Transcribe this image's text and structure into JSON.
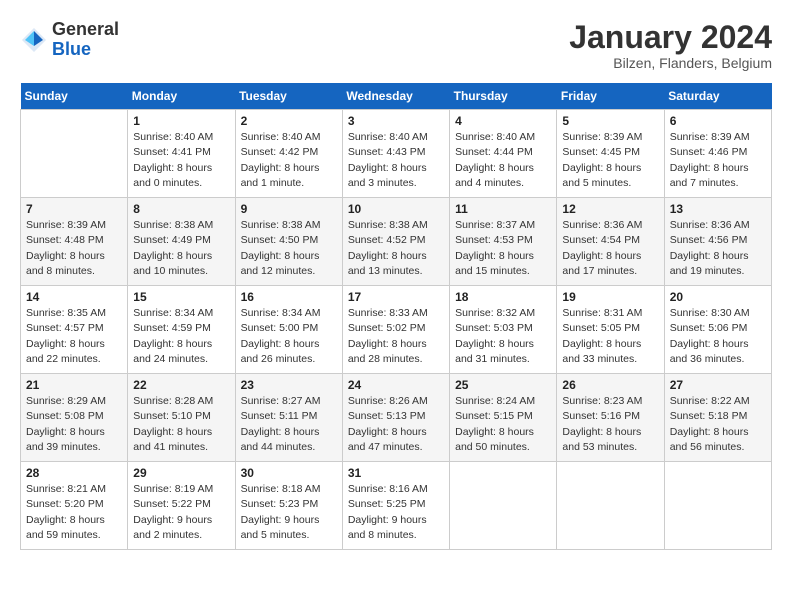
{
  "logo": {
    "general": "General",
    "blue": "Blue"
  },
  "header": {
    "month": "January 2024",
    "location": "Bilzen, Flanders, Belgium"
  },
  "weekdays": [
    "Sunday",
    "Monday",
    "Tuesday",
    "Wednesday",
    "Thursday",
    "Friday",
    "Saturday"
  ],
  "weeks": [
    [
      {
        "day": "",
        "sunrise": "",
        "sunset": "",
        "daylight": ""
      },
      {
        "day": "1",
        "sunrise": "Sunrise: 8:40 AM",
        "sunset": "Sunset: 4:41 PM",
        "daylight": "Daylight: 8 hours and 0 minutes."
      },
      {
        "day": "2",
        "sunrise": "Sunrise: 8:40 AM",
        "sunset": "Sunset: 4:42 PM",
        "daylight": "Daylight: 8 hours and 1 minute."
      },
      {
        "day": "3",
        "sunrise": "Sunrise: 8:40 AM",
        "sunset": "Sunset: 4:43 PM",
        "daylight": "Daylight: 8 hours and 3 minutes."
      },
      {
        "day": "4",
        "sunrise": "Sunrise: 8:40 AM",
        "sunset": "Sunset: 4:44 PM",
        "daylight": "Daylight: 8 hours and 4 minutes."
      },
      {
        "day": "5",
        "sunrise": "Sunrise: 8:39 AM",
        "sunset": "Sunset: 4:45 PM",
        "daylight": "Daylight: 8 hours and 5 minutes."
      },
      {
        "day": "6",
        "sunrise": "Sunrise: 8:39 AM",
        "sunset": "Sunset: 4:46 PM",
        "daylight": "Daylight: 8 hours and 7 minutes."
      }
    ],
    [
      {
        "day": "7",
        "sunrise": "Sunrise: 8:39 AM",
        "sunset": "Sunset: 4:48 PM",
        "daylight": "Daylight: 8 hours and 8 minutes."
      },
      {
        "day": "8",
        "sunrise": "Sunrise: 8:38 AM",
        "sunset": "Sunset: 4:49 PM",
        "daylight": "Daylight: 8 hours and 10 minutes."
      },
      {
        "day": "9",
        "sunrise": "Sunrise: 8:38 AM",
        "sunset": "Sunset: 4:50 PM",
        "daylight": "Daylight: 8 hours and 12 minutes."
      },
      {
        "day": "10",
        "sunrise": "Sunrise: 8:38 AM",
        "sunset": "Sunset: 4:52 PM",
        "daylight": "Daylight: 8 hours and 13 minutes."
      },
      {
        "day": "11",
        "sunrise": "Sunrise: 8:37 AM",
        "sunset": "Sunset: 4:53 PM",
        "daylight": "Daylight: 8 hours and 15 minutes."
      },
      {
        "day": "12",
        "sunrise": "Sunrise: 8:36 AM",
        "sunset": "Sunset: 4:54 PM",
        "daylight": "Daylight: 8 hours and 17 minutes."
      },
      {
        "day": "13",
        "sunrise": "Sunrise: 8:36 AM",
        "sunset": "Sunset: 4:56 PM",
        "daylight": "Daylight: 8 hours and 19 minutes."
      }
    ],
    [
      {
        "day": "14",
        "sunrise": "Sunrise: 8:35 AM",
        "sunset": "Sunset: 4:57 PM",
        "daylight": "Daylight: 8 hours and 22 minutes."
      },
      {
        "day": "15",
        "sunrise": "Sunrise: 8:34 AM",
        "sunset": "Sunset: 4:59 PM",
        "daylight": "Daylight: 8 hours and 24 minutes."
      },
      {
        "day": "16",
        "sunrise": "Sunrise: 8:34 AM",
        "sunset": "Sunset: 5:00 PM",
        "daylight": "Daylight: 8 hours and 26 minutes."
      },
      {
        "day": "17",
        "sunrise": "Sunrise: 8:33 AM",
        "sunset": "Sunset: 5:02 PM",
        "daylight": "Daylight: 8 hours and 28 minutes."
      },
      {
        "day": "18",
        "sunrise": "Sunrise: 8:32 AM",
        "sunset": "Sunset: 5:03 PM",
        "daylight": "Daylight: 8 hours and 31 minutes."
      },
      {
        "day": "19",
        "sunrise": "Sunrise: 8:31 AM",
        "sunset": "Sunset: 5:05 PM",
        "daylight": "Daylight: 8 hours and 33 minutes."
      },
      {
        "day": "20",
        "sunrise": "Sunrise: 8:30 AM",
        "sunset": "Sunset: 5:06 PM",
        "daylight": "Daylight: 8 hours and 36 minutes."
      }
    ],
    [
      {
        "day": "21",
        "sunrise": "Sunrise: 8:29 AM",
        "sunset": "Sunset: 5:08 PM",
        "daylight": "Daylight: 8 hours and 39 minutes."
      },
      {
        "day": "22",
        "sunrise": "Sunrise: 8:28 AM",
        "sunset": "Sunset: 5:10 PM",
        "daylight": "Daylight: 8 hours and 41 minutes."
      },
      {
        "day": "23",
        "sunrise": "Sunrise: 8:27 AM",
        "sunset": "Sunset: 5:11 PM",
        "daylight": "Daylight: 8 hours and 44 minutes."
      },
      {
        "day": "24",
        "sunrise": "Sunrise: 8:26 AM",
        "sunset": "Sunset: 5:13 PM",
        "daylight": "Daylight: 8 hours and 47 minutes."
      },
      {
        "day": "25",
        "sunrise": "Sunrise: 8:24 AM",
        "sunset": "Sunset: 5:15 PM",
        "daylight": "Daylight: 8 hours and 50 minutes."
      },
      {
        "day": "26",
        "sunrise": "Sunrise: 8:23 AM",
        "sunset": "Sunset: 5:16 PM",
        "daylight": "Daylight: 8 hours and 53 minutes."
      },
      {
        "day": "27",
        "sunrise": "Sunrise: 8:22 AM",
        "sunset": "Sunset: 5:18 PM",
        "daylight": "Daylight: 8 hours and 56 minutes."
      }
    ],
    [
      {
        "day": "28",
        "sunrise": "Sunrise: 8:21 AM",
        "sunset": "Sunset: 5:20 PM",
        "daylight": "Daylight: 8 hours and 59 minutes."
      },
      {
        "day": "29",
        "sunrise": "Sunrise: 8:19 AM",
        "sunset": "Sunset: 5:22 PM",
        "daylight": "Daylight: 9 hours and 2 minutes."
      },
      {
        "day": "30",
        "sunrise": "Sunrise: 8:18 AM",
        "sunset": "Sunset: 5:23 PM",
        "daylight": "Daylight: 9 hours and 5 minutes."
      },
      {
        "day": "31",
        "sunrise": "Sunrise: 8:16 AM",
        "sunset": "Sunset: 5:25 PM",
        "daylight": "Daylight: 9 hours and 8 minutes."
      },
      {
        "day": "",
        "sunrise": "",
        "sunset": "",
        "daylight": ""
      },
      {
        "day": "",
        "sunrise": "",
        "sunset": "",
        "daylight": ""
      },
      {
        "day": "",
        "sunrise": "",
        "sunset": "",
        "daylight": ""
      }
    ]
  ]
}
